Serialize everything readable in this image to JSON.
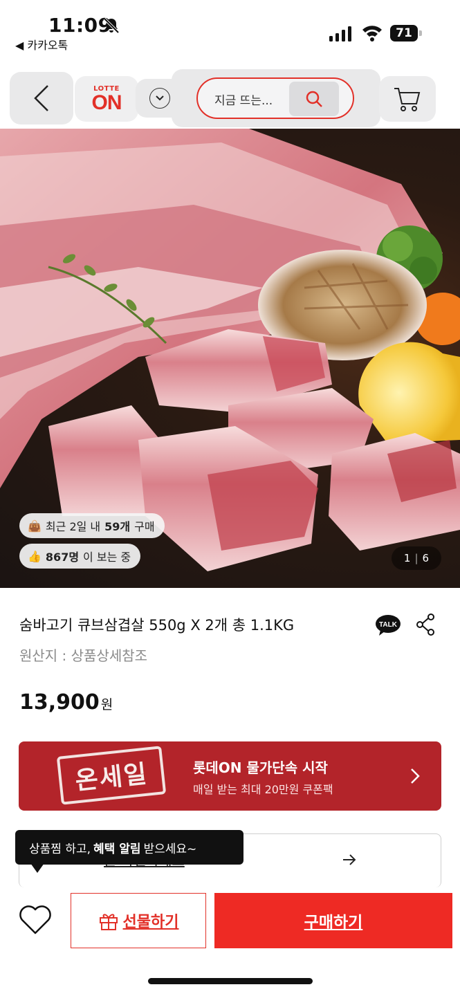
{
  "status_bar": {
    "time": "11:09",
    "back_app_label": "◀ 카카오톡",
    "battery": "71"
  },
  "nav": {
    "logo_top": "LOTTE",
    "logo_main": "ON",
    "search_placeholder": "지금 뜨는...",
    "brand_color": "#e23028"
  },
  "product": {
    "badges": [
      {
        "icon": "shopping-bag-icon",
        "prefix": "최근 2일 내 ",
        "strong": "59개",
        "suffix": " 구매"
      },
      {
        "icon": "thumbs-up-icon",
        "prefix": "",
        "strong": "867명",
        "suffix": "이 보는 중"
      }
    ],
    "image_counter": {
      "current": "1",
      "total": "6"
    },
    "title": "숨바고기 큐브삼겹살 550g X 2개 총 1.1KG",
    "talk_label": "TALK",
    "origin": "원산지 : 상품상세참조",
    "price": "13,900",
    "price_unit": "원"
  },
  "banner": {
    "stamp": "온세일",
    "title": "롯데ON 물가단속 시작",
    "subtitle": "매일 받는 최대 20만원 쿠폰팩",
    "color": "#b3242a"
  },
  "coupon": {
    "link_text": "을 확인하세요"
  },
  "tooltip": {
    "prefix": "상품찜 하고,",
    "strong": "혜택 알림",
    "suffix": "받으세요~"
  },
  "bottom_bar": {
    "gift_label": "선물하기",
    "buy_label": "구매하기",
    "buy_color": "#ee2a24"
  }
}
